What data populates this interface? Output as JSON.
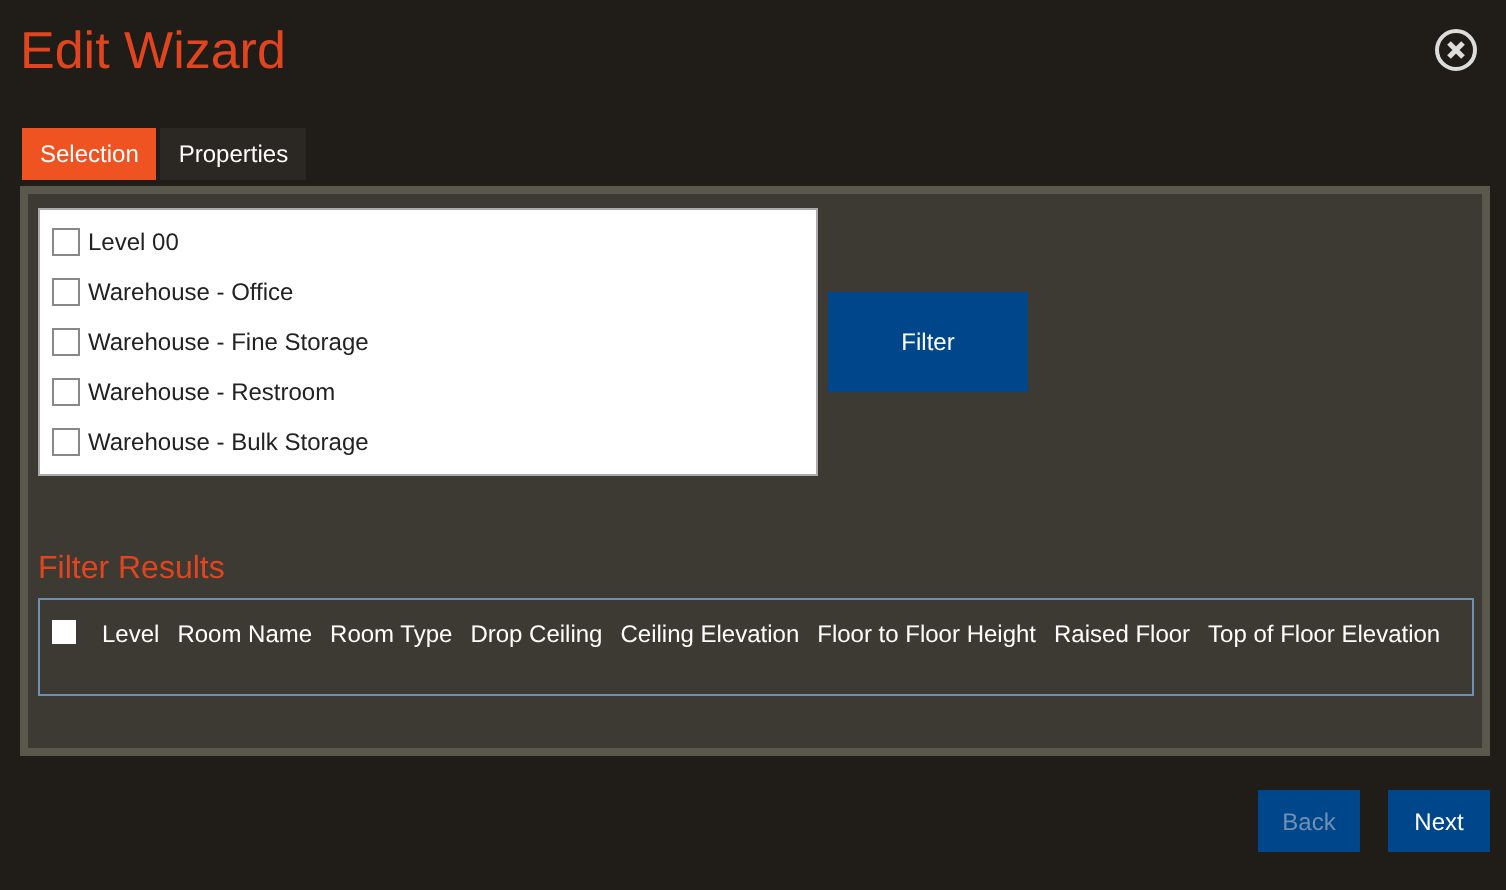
{
  "window": {
    "title": "Edit Wizard"
  },
  "tabs": [
    {
      "label": "Selection",
      "selected": true
    },
    {
      "label": "Properties",
      "selected": false
    }
  ],
  "levels": [
    {
      "label": "Level 00",
      "checked": false
    },
    {
      "label": "Warehouse - Office",
      "checked": false
    },
    {
      "label": "Warehouse - Fine Storage",
      "checked": false
    },
    {
      "label": "Warehouse - Restroom",
      "checked": false
    },
    {
      "label": "Warehouse - Bulk Storage",
      "checked": false
    }
  ],
  "filter_button": "Filter",
  "results": {
    "title": "Filter Results",
    "select_all": false,
    "columns": [
      "Level",
      "Room Name",
      "Room Type",
      "Drop Ceiling",
      "Ceiling Elevation",
      "Floor to Floor Height",
      "Raised Floor",
      "Top of Floor Elevation"
    ]
  },
  "buttons": [
    {
      "label": "Back",
      "disabled": true
    },
    {
      "label": "Next",
      "disabled": false
    }
  ]
}
